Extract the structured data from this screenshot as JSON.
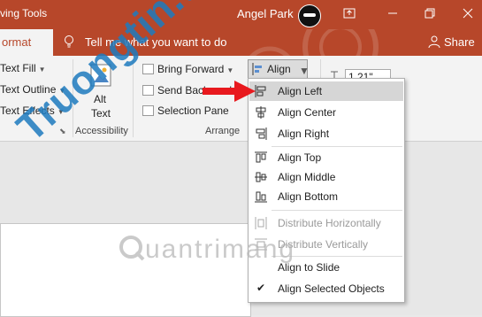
{
  "titlebar": {
    "context": "ving Tools",
    "user_name": "Angel Park"
  },
  "tabs": {
    "active": "ormat",
    "tell_me": "Tell me what you want to do",
    "share": "Share"
  },
  "ribbon": {
    "text_fill": "Text Fill",
    "text_outline": "Text Outline",
    "text_effects": "Text Effects",
    "alt_text_line1": "Alt",
    "alt_text_line2": "Text",
    "accessibility": "Accessibility",
    "bring_forward": "Bring Forward",
    "send_backward": "Send Backward",
    "selection_pane": "Selection Pane",
    "arrange": "Arrange",
    "align": "Align",
    "height_value": "1.21\""
  },
  "align_menu": {
    "items": [
      {
        "label": "Align Left",
        "icon": "align-left-icon"
      },
      {
        "label": "Align Center",
        "icon": "align-center-icon"
      },
      {
        "label": "Align Right",
        "icon": "align-right-icon"
      },
      {
        "label": "Align Top",
        "icon": "align-top-icon"
      },
      {
        "label": "Align Middle",
        "icon": "align-middle-icon"
      },
      {
        "label": "Align Bottom",
        "icon": "align-bottom-icon"
      },
      {
        "label": "Distribute Horizontally",
        "icon": "distribute-horizontally-icon"
      },
      {
        "label": "Distribute Vertically",
        "icon": "distribute-vertically-icon"
      },
      {
        "label": "Align to Slide",
        "icon": ""
      },
      {
        "label": "Align Selected Objects",
        "icon": "checkmark-icon"
      }
    ]
  },
  "watermark": {
    "main": "Truongtin.top",
    "secondary": "uantrimang"
  },
  "colors": {
    "accent": "#b7472a",
    "arrow": "#e8191e",
    "watermark": "#1e7bbf"
  }
}
